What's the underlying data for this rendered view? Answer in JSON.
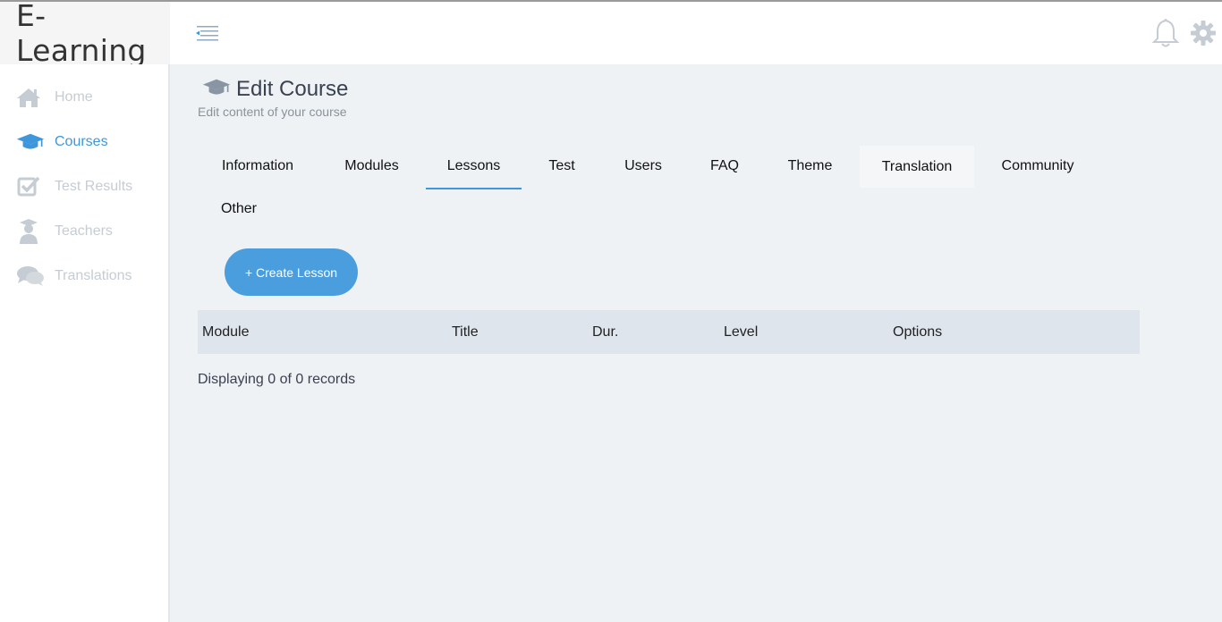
{
  "app": {
    "brand": "E-Learning"
  },
  "sidebar": {
    "items": [
      {
        "label": "Home",
        "icon": "home-icon",
        "active": false
      },
      {
        "label": "Courses",
        "icon": "graduation-cap-icon",
        "active": true
      },
      {
        "label": "Test Results",
        "icon": "checkbox-icon",
        "active": false
      },
      {
        "label": "Teachers",
        "icon": "teacher-icon",
        "active": false
      },
      {
        "label": "Translations",
        "icon": "chat-bubbles-icon",
        "active": false
      }
    ]
  },
  "header": {
    "menu_icon": "menu-collapse-icon",
    "notification_icon": "bell-icon",
    "settings_icon": "gear-icon"
  },
  "page": {
    "title": "Edit Course",
    "subtitle": "Edit content of your course"
  },
  "tabs": [
    {
      "label": "Information"
    },
    {
      "label": "Modules"
    },
    {
      "label": "Lessons",
      "active": true
    },
    {
      "label": "Test"
    },
    {
      "label": "Users"
    },
    {
      "label": "FAQ"
    },
    {
      "label": "Theme"
    },
    {
      "label": "Translation",
      "hover": true
    },
    {
      "label": "Community"
    },
    {
      "label": "Other"
    }
  ],
  "actions": {
    "create_lesson": "+ Create Lesson"
  },
  "table": {
    "columns": [
      "Module",
      "Title",
      "Dur.",
      "Level",
      "Options"
    ],
    "rows": []
  },
  "footer": {
    "records_text": "Displaying 0 of 0 records"
  },
  "colors": {
    "accent": "#3f97db",
    "sidebar_muted": "#c6ccd3",
    "background": "#eef2f5"
  }
}
